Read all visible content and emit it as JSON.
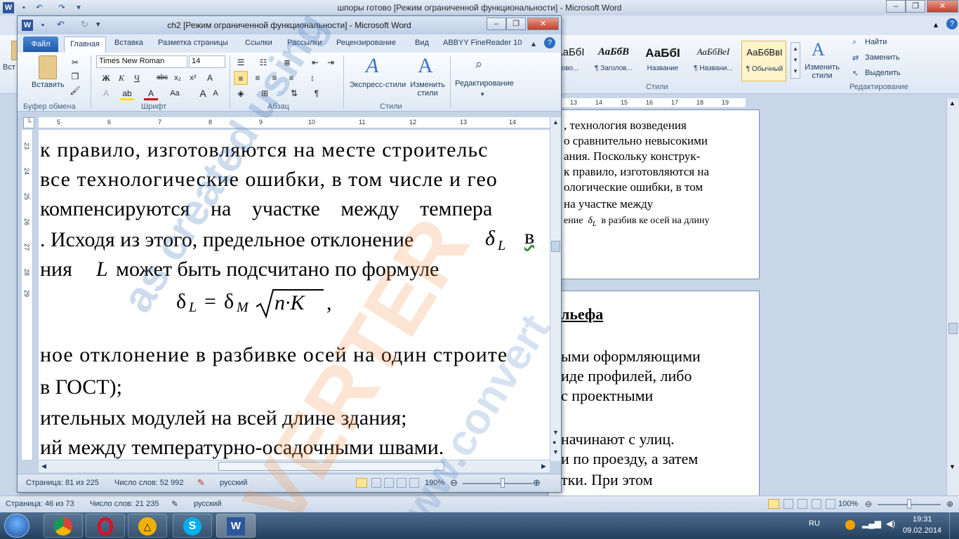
{
  "back_window": {
    "title": "шпоры готово [Режим ограниченной функциональности]  -  Microsoft Word",
    "ribbon_cut_label": "Вст",
    "styles": [
      {
        "sample": "АаБбВ",
        "name": "¶ Обычный"
      },
      {
        "sample": "АаБбІ",
        "name": "ово..."
      },
      {
        "sample": "АаБбВ",
        "name": "¶ Заголов..."
      },
      {
        "sample": "АаБбІ",
        "name": "Название"
      },
      {
        "sample": "АаБбВеІ",
        "name": "¶ Названи..."
      },
      {
        "sample": "АаБбВвІ",
        "name": "¶ Обычный"
      }
    ],
    "change_styles": "Изменить стили",
    "find": "Найти",
    "replace": "Заменить",
    "select": "Выделить",
    "group_styles": "Стили",
    "group_editing": "Редактирование",
    "ruler_numbers": [
      "13",
      "14",
      "15",
      "16",
      "17",
      "18",
      "19"
    ],
    "page1_lines": [
      ", технология возведения",
      "о сравнительно невысокими",
      "ания. Поскольку конструк-",
      "к правило, изготовляются на",
      "ологические ошибки, в том",
      "на участке между"
    ],
    "page1_formula_prefix": "ение",
    "page1_formula_symbol": "δ",
    "page1_formula_sub": "L",
    "page1_formula_rest": "в разбив ке осей на длину",
    "page2_heading": "льефа",
    "page2_lines": [
      "ыми оформляющими",
      "иде профилей, либо",
      "с проектными",
      "",
      "начинают с улиц.",
      "и по проезду, а затем",
      "тки. При этом"
    ],
    "status": {
      "page": "Страница: 46 из 73",
      "words": "Число слов: 21 235",
      "lang": "русский",
      "zoom": "100%"
    }
  },
  "front_window": {
    "title": "ch2 [Режим ограниченной функциональности]  -  Microsoft Word",
    "tabs": [
      "Файл",
      "Главная",
      "Вставка",
      "Разметка страницы",
      "Ссылки",
      "Рассылки",
      "Рецензирование",
      "Вид",
      "ABBYY FineReader 10"
    ],
    "clipboard": {
      "paste": "Вставить",
      "group": "Буфер обмена"
    },
    "font": {
      "name": "Times New Roman",
      "size": "14",
      "group": "Шрифт"
    },
    "paragraph_group": "Абзац",
    "styles": {
      "express": "Экспресс-стили",
      "change": "Изменить стили",
      "group": "Стили"
    },
    "editing": {
      "label": "Редактирование"
    },
    "ruler_numbers": [
      "5",
      "6",
      "7",
      "8",
      "9",
      "10",
      "11",
      "12",
      "13",
      "14"
    ],
    "vruler_numbers": [
      "23",
      "24",
      "25",
      "26",
      "27",
      "28",
      "29"
    ],
    "doc_lines": [
      "к правило, изготовляются на месте строительс",
      "все технологические ошибки, в том числе и гео",
      "компенсируются на участке между темпера",
      ". Исходя из этого, предельное отклонение",
      "ния",
      "может быть подсчитано по формуле",
      "ное отклонение в разбивке осей на один строите",
      "в ГОСТ);",
      "ительных модулей на всей длине здания;",
      "ий между температурно-осадочными швами."
    ],
    "doc_symbol_delta": "δ",
    "doc_sub_L": "L",
    "doc_word_v": "в",
    "doc_var_L": "L",
    "formula": {
      "lhs": "δ",
      "lhs_sub": "L",
      "eq": "=",
      "rhs": "δ",
      "rhs_sub": "M",
      "radicand": "n·K",
      "tail": ","
    },
    "status": {
      "page": "Страница: 81 из 225",
      "words": "Число слов: 52 992",
      "lang": "русский",
      "zoom": "190%"
    }
  },
  "watermark": {
    "line1": "as created using",
    "line2": "VERTER",
    "line3": "ww.convert"
  },
  "taskbar": {
    "apps": [
      "Пуск",
      "Google Chrome",
      "Opera",
      "Microsoft Office",
      "Skype",
      "Microsoft Word"
    ],
    "lang": "RU",
    "time": "19:31",
    "date": "09.02.2014"
  },
  "colors": {
    "accent": "#2b579a",
    "file_tab": "#1f5aaa",
    "watermark_blue": "#4a7cc0",
    "watermark_orange": "#f08a3a"
  }
}
